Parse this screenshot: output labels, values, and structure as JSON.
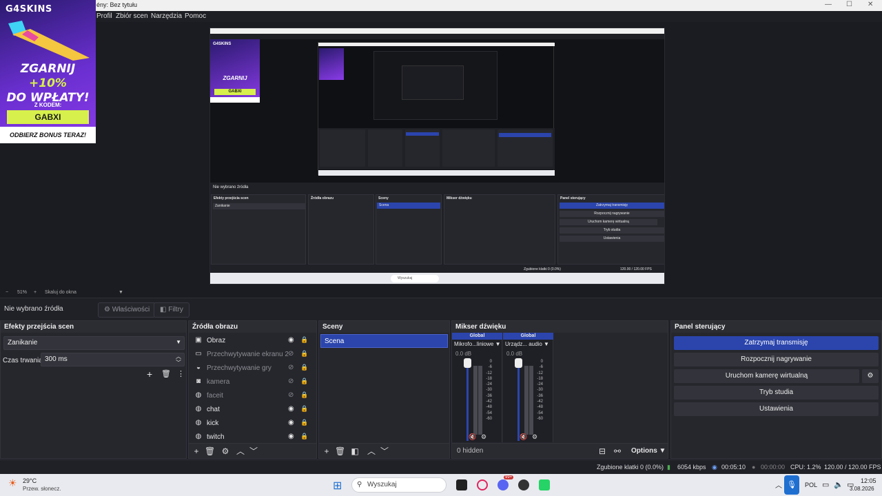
{
  "window": {
    "title": "ény: Bez tytułu",
    "controls": [
      "—",
      "☐",
      "✕"
    ]
  },
  "menu": {
    "items": [
      "Profil",
      "Zbiór scen",
      "Narzędzia",
      "Pomoc"
    ]
  },
  "ad": {
    "logo": "G4SKINS",
    "promo_line1": "ZGARNIJ",
    "promo_bonus": "+10%",
    "promo_line2": "DO WPŁATY!",
    "code_label": "Z KODEM:",
    "code": "GABXI",
    "cta": "ODBIERZ BONUS TERAZ!"
  },
  "zoom": {
    "minus": "−",
    "level": "51%",
    "plus": "+",
    "scale_label": "Skaluj do okna"
  },
  "source_toolbar": {
    "label": "Nie wybrano źródła",
    "properties": "Właściwości",
    "filters": "Filtry"
  },
  "transitions": {
    "title": "Efekty przejścia scen",
    "selected": "Zanikanie",
    "duration_label": "Czas trwania",
    "duration_value": "300 ms"
  },
  "sources": {
    "title": "Źródła obrazu",
    "items": [
      {
        "name": "Obraz",
        "icon": "image-icon",
        "visible": true
      },
      {
        "name": "Przechwytywanie ekranu 2",
        "icon": "monitor-icon",
        "visible": false
      },
      {
        "name": "Przechwytywanie gry",
        "icon": "gamepad-icon",
        "visible": false
      },
      {
        "name": "kamera",
        "icon": "camera-icon",
        "visible": false
      },
      {
        "name": "faceit",
        "icon": "globe-icon",
        "visible": false
      },
      {
        "name": "chat",
        "icon": "globe-icon",
        "visible": true
      },
      {
        "name": "kick",
        "icon": "globe-icon",
        "visible": true
      },
      {
        "name": "twitch",
        "icon": "globe-icon",
        "visible": true
      }
    ]
  },
  "scenes": {
    "title": "Sceny",
    "items": [
      "Scena"
    ]
  },
  "mixer": {
    "title": "Mikser dźwięku",
    "channels": [
      {
        "header": "Global",
        "name": "Mikrofo...liniowe",
        "db": "0.0 dB"
      },
      {
        "header": "Global",
        "name": "Urządz... audio",
        "db": "0.0 dB"
      }
    ],
    "scale": [
      "0",
      "-6",
      "-12",
      "-18",
      "-24",
      "-30",
      "-36",
      "-42",
      "-48",
      "-54",
      "-60"
    ],
    "hidden_label": "0 hidden",
    "options_label": "Options"
  },
  "controls": {
    "title": "Panel sterujący",
    "stop_stream": "Zatrzymaj transmisję",
    "start_record": "Rozpocznij nagrywanie",
    "virtual_cam": "Uruchom kamerę wirtualną",
    "studio_mode": "Tryb studia",
    "settings": "Ustawienia"
  },
  "status": {
    "dropped": "Zgubione klatki 0 (0.0%)",
    "bitrate": "6054 kbps",
    "stream_time": "00:05:10",
    "record_time": "00:00:00",
    "cpu": "CPU: 1.2%",
    "fps": "120.00 / 120.00 FPS"
  },
  "taskbar": {
    "weather_temp": "29°C",
    "weather_desc": "Przew. słonecz.",
    "search_placeholder": "Wyszukaj",
    "language": "POL",
    "time": "12:05",
    "date": "3.08.2026",
    "badge": "99+"
  },
  "colors": {
    "accent": "#2b45ad",
    "panel": "#26272d",
    "background": "#202127",
    "ad_code": "#d7f04b"
  }
}
